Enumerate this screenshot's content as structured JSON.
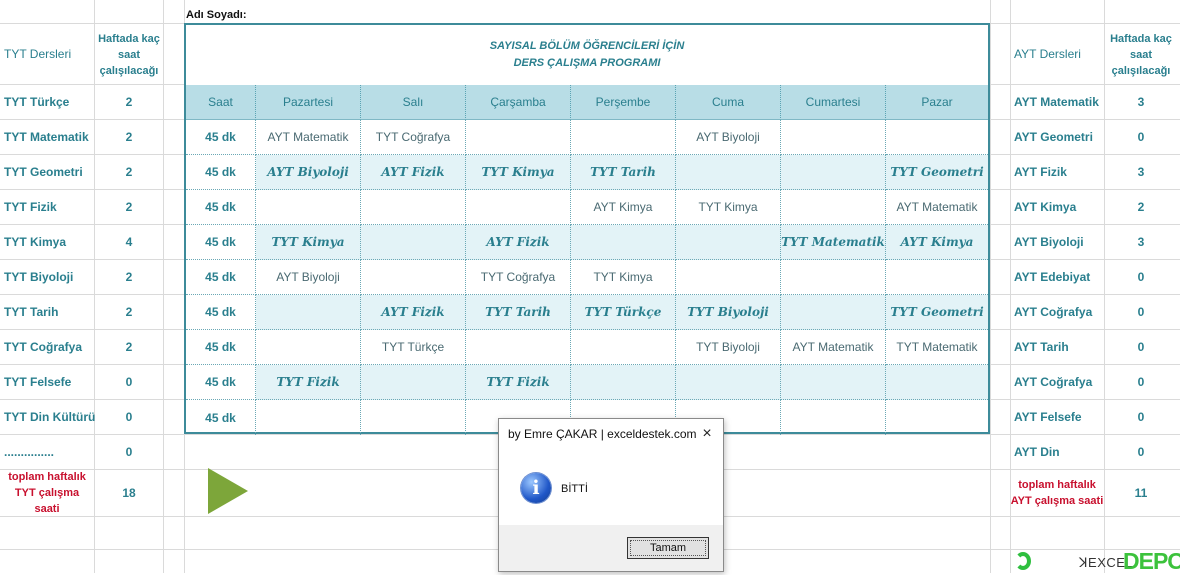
{
  "name_label": "Adı Soyadı:",
  "left_table": {
    "header_course": "TYT Dersleri",
    "header_hours": "Haftada kaç saat çalışılacağı",
    "rows": [
      {
        "course": "TYT Türkçe",
        "hours": "2"
      },
      {
        "course": "TYT Matematik",
        "hours": "2"
      },
      {
        "course": "TYT Geometri",
        "hours": "2"
      },
      {
        "course": "TYT Fizik",
        "hours": "2"
      },
      {
        "course": "TYT Kimya",
        "hours": "4"
      },
      {
        "course": "TYT Biyoloji",
        "hours": "2"
      },
      {
        "course": "TYT Tarih",
        "hours": "2"
      },
      {
        "course": "TYT Coğrafya",
        "hours": "2"
      },
      {
        "course": "TYT Felsefe",
        "hours": "0"
      },
      {
        "course": "TYT Din Kültürü",
        "hours": "0"
      },
      {
        "course": "...............",
        "hours": "0"
      }
    ],
    "total_label": "toplam haftalık TYT çalışma saati",
    "total_value": "18"
  },
  "right_table": {
    "header_course": "AYT Dersleri",
    "header_hours": "Haftada kaç saat çalışılacağı",
    "rows": [
      {
        "course": "AYT Matematik",
        "hours": "3"
      },
      {
        "course": "AYT Geometri",
        "hours": "0"
      },
      {
        "course": "AYT Fizik",
        "hours": "3"
      },
      {
        "course": "AYT Kimya",
        "hours": "2"
      },
      {
        "course": "AYT Biyoloji",
        "hours": "3"
      },
      {
        "course": "AYT Edebiyat",
        "hours": "0"
      },
      {
        "course": "AYT Coğrafya",
        "hours": "0"
      },
      {
        "course": "AYT Tarih",
        "hours": "0"
      },
      {
        "course": "AYT Coğrafya",
        "hours": "0"
      },
      {
        "course": "AYT Felsefe",
        "hours": "0"
      },
      {
        "course": "AYT Din",
        "hours": "0"
      }
    ],
    "total_label": "toplam haftalık AYT çalışma saati",
    "total_value": "11"
  },
  "schedule": {
    "title_line1": "SAYISAL BÖLÜM ÖĞRENCİLERİ İÇİN",
    "title_line2": "DERS ÇALIŞMA PROGRAMI",
    "columns": [
      "Saat",
      "Pazartesi",
      "Salı",
      "Çarşamba",
      "Perşembe",
      "Cuma",
      "Cumartesi",
      "Pazar"
    ],
    "rows": [
      [
        "45 dk",
        "AYT Matematik",
        "TYT Coğrafya",
        "",
        "",
        "AYT Biyoloji",
        "",
        ""
      ],
      [
        "45 dk",
        "AYT Biyoloji",
        "AYT Fizik",
        "TYT Kimya",
        "TYT Tarih",
        "",
        "",
        "TYT Geometri"
      ],
      [
        "45 dk",
        "",
        "",
        "",
        "AYT Kimya",
        "TYT Kimya",
        "",
        "AYT Matematik"
      ],
      [
        "45 dk",
        "TYT Kimya",
        "",
        "AYT Fizik",
        "",
        "",
        "TYT Matematik",
        "AYT Kimya"
      ],
      [
        "45 dk",
        "AYT Biyoloji",
        "",
        "TYT Coğrafya",
        "TYT Kimya",
        "",
        "",
        ""
      ],
      [
        "45 dk",
        "",
        "AYT Fizik",
        "TYT Tarih",
        "TYT Türkçe",
        "TYT Biyoloji",
        "",
        "TYT Geometri"
      ],
      [
        "45 dk",
        "",
        "TYT Türkçe",
        "",
        "",
        "TYT Biyoloji",
        "AYT Matematik",
        "TYT Matematik"
      ],
      [
        "45 dk",
        "TYT Fizik",
        "",
        "TYT Fizik",
        "",
        "",
        "",
        ""
      ],
      [
        "45 dk",
        "",
        "",
        "",
        "",
        "",
        "",
        ""
      ]
    ]
  },
  "dialog": {
    "title": "by Emre ÇAKAR | exceldestek.com",
    "close_icon": "×",
    "message": "BİTTİ",
    "ok_label": "Tamam",
    "info_glyph": "i"
  },
  "logo": {
    "text1": "EXCEL",
    "text2": "DEPO"
  }
}
